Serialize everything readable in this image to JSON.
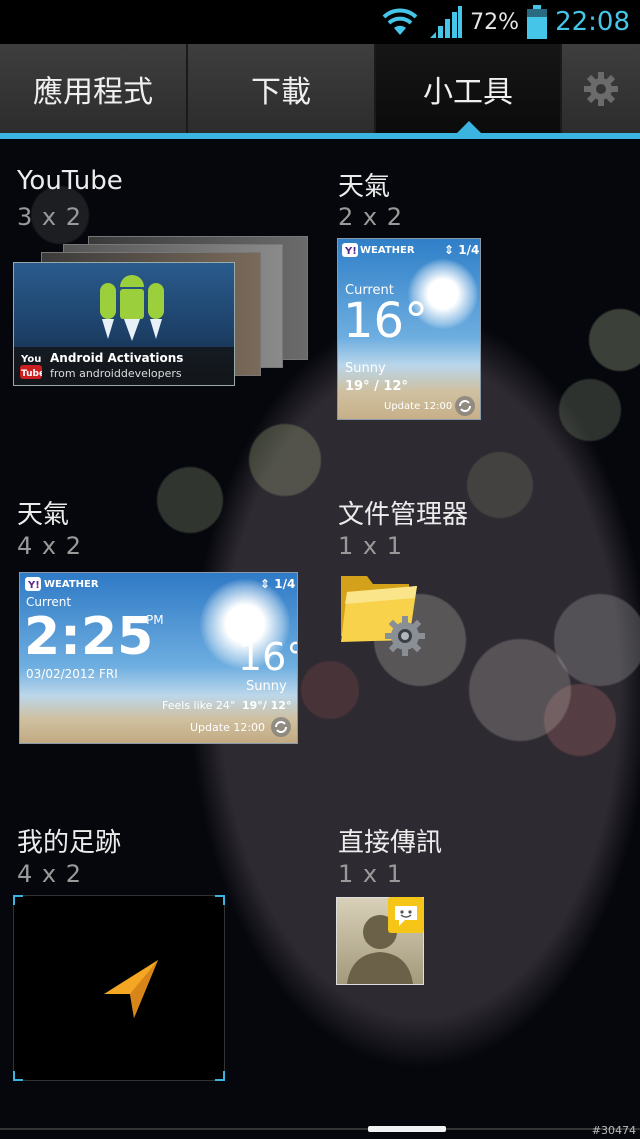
{
  "status_bar": {
    "battery_percent": "72%",
    "time": "22:08",
    "battery_level": 0.72,
    "icons": [
      "wifi-icon",
      "signal-icon",
      "battery-icon"
    ]
  },
  "tabs": [
    {
      "label": "應用程式",
      "active": false
    },
    {
      "label": "下載",
      "active": false
    },
    {
      "label": "小工具",
      "active": true
    }
  ],
  "settings_icon": "gear-icon",
  "accent_color": "#3bb5e0",
  "widgets": [
    {
      "name": "YouTube",
      "size": "3 x 2",
      "preview": {
        "title": "Android Activations",
        "subtitle": "from androiddevelopers",
        "logo_text_top": "You",
        "logo_text_bottom": "Tube"
      }
    },
    {
      "name": "天氣",
      "size": "2 x 2",
      "preview": {
        "brand": "WEATHER",
        "page": "1/4",
        "label": "Current",
        "temp": "16°",
        "condition": "Sunny",
        "range": "19° / 12°",
        "update": "Update 12:00"
      }
    },
    {
      "name": "天氣",
      "size": "4 x 2",
      "preview": {
        "brand": "WEATHER",
        "page": "1/4",
        "label": "Current",
        "time": "2:25",
        "ampm": "PM",
        "date": "03/02/2012 FRI",
        "temp": "16°",
        "condition": "Sunny",
        "feels": "Feels like 24°",
        "range": "19°/ 12°",
        "update": "Update 12:00"
      }
    },
    {
      "name": "文件管理器",
      "size": "1 x 1",
      "icon": "folder-gear-icon"
    },
    {
      "name": "我的足跡",
      "size": "4 x 2",
      "icon": "navigation-arrow-icon"
    },
    {
      "name": "直接傳訊",
      "size": "1 x 1",
      "icon": "contact-avatar-icon"
    }
  ],
  "watermark": "#30474"
}
